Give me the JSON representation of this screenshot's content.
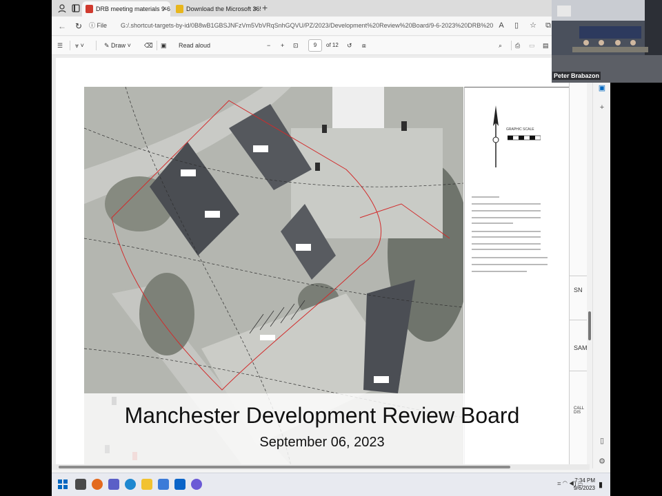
{
  "browser": {
    "tabs": [
      {
        "title": "DRB meeting materials 9-6-23.p",
        "active": true,
        "favicon_color": "#d03a2e"
      },
      {
        "title": "Download the Microsoft 365 Mo",
        "active": false,
        "favicon_color": "#e8b61c"
      }
    ],
    "file_chip": "File",
    "url": "G:/.shortcut-targets-by-id/0B8wB1GBSJNFzVm5VbVRqSnhGQVU/PZ/2023/Development%20Review%20Board/9-6-2023%20DRB%20Meeting/DRB%20meeting..."
  },
  "pdf_toolbar": {
    "draw_label": "Draw",
    "read_aloud_label": "Read aloud",
    "current_page": "9",
    "page_total": "of 12"
  },
  "map": {
    "legend_title": "GRAPHIC SCALE",
    "building_labels": [
      "EXISTING BUILDING",
      "MIXED RETAIL",
      "EXISTING SHED",
      "PROPOSED",
      "PARKING",
      "EXISTING BUILDING"
    ]
  },
  "side_panel": {
    "labels": [
      "SN",
      "SAM",
      "CALL DIS"
    ]
  },
  "banner": {
    "title": "Manchester Development Review Board",
    "date": "September 06, 2023"
  },
  "taskbar": {
    "time": "7:34 PM",
    "date": "9/6/2023"
  },
  "video": {
    "participant_name": "Peter Brabazon"
  },
  "colors": {
    "accent": "#0067c0",
    "map_base": "#b7b9b3",
    "property_line": "#d22a2a"
  }
}
